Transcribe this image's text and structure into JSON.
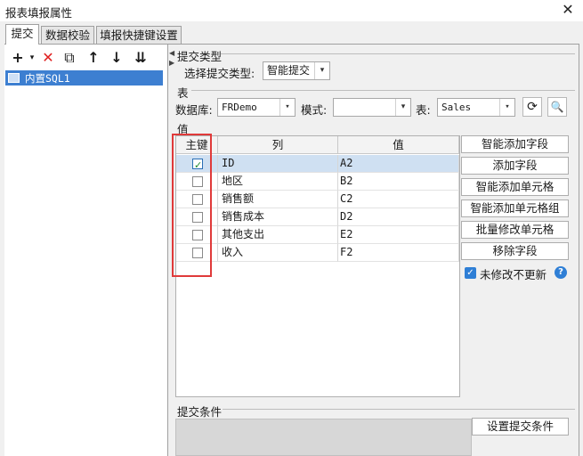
{
  "window": {
    "title": "报表填报属性",
    "close_icon": "✕"
  },
  "tabs": [
    {
      "label": "提交",
      "active": true
    },
    {
      "label": "数据校验",
      "active": false
    },
    {
      "label": "填报快捷键设置",
      "active": false
    }
  ],
  "toolbar": {
    "add": "+",
    "dropdown": "▾",
    "delete": "✕",
    "copy": "⧉",
    "up": "↑",
    "down": "↓",
    "more": "⇊"
  },
  "tree": {
    "items": [
      {
        "label": "内置SQL1",
        "selected": true
      }
    ]
  },
  "submit_type": {
    "section": "提交类型",
    "label": "选择提交类型:",
    "value": "智能提交"
  },
  "table_section": {
    "section": "表",
    "db_label": "数据库:",
    "db_value": "FRDemo",
    "schema_label": "模式:",
    "schema_value": "",
    "table_label": "表:",
    "table_value": "Sales"
  },
  "value_section": {
    "section": "值",
    "headers": {
      "key": "主键",
      "col": "列",
      "val": "值"
    },
    "rows": [
      {
        "key": true,
        "col": "ID",
        "val": "A2",
        "selected": true
      },
      {
        "key": false,
        "col": "地区",
        "val": "B2"
      },
      {
        "key": false,
        "col": "销售额",
        "val": "C2"
      },
      {
        "key": false,
        "col": "销售成本",
        "val": "D2"
      },
      {
        "key": false,
        "col": "其他支出",
        "val": "E2"
      },
      {
        "key": false,
        "col": "收入",
        "val": "F2"
      }
    ]
  },
  "right_buttons": {
    "smart_add_field": "智能添加字段",
    "add_field": "添加字段",
    "smart_add_cell": "智能添加单元格",
    "smart_add_cell_group": "智能添加单元格组",
    "batch_edit_cell": "批量修改单元格",
    "remove_field": "移除字段"
  },
  "no_update": {
    "label": "未修改不更新",
    "checked": true,
    "help": "?"
  },
  "submit_condition": {
    "section": "提交条件",
    "button": "设置提交条件"
  },
  "colors": {
    "accent": "#3d7fd1",
    "highlight": "#cfe0f2",
    "red_box": "#e03a3a"
  }
}
